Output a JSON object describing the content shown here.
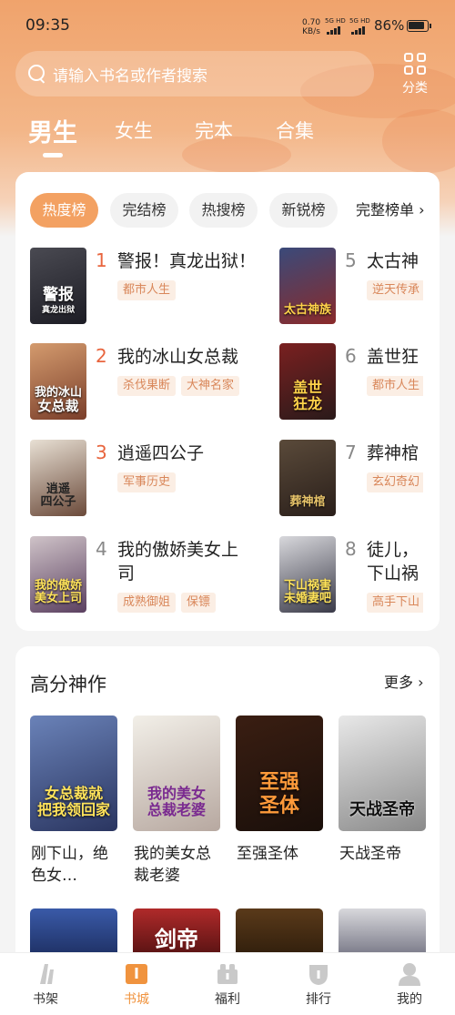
{
  "status_bar": {
    "time": "09:35",
    "speed_value": "0.70",
    "speed_unit": "KB/s",
    "sim1": "5G HD",
    "sim2": "5G HD",
    "battery": "86%"
  },
  "search": {
    "placeholder": "请输入书名或作者搜索"
  },
  "category_button": {
    "label": "分类",
    "icon": "grid-icon"
  },
  "tabs": [
    {
      "label": "男生",
      "active": true
    },
    {
      "label": "女生",
      "active": false
    },
    {
      "label": "完本",
      "active": false
    },
    {
      "label": "合集",
      "active": false
    }
  ],
  "ranking": {
    "tabs": [
      {
        "label": "热度榜",
        "active": true
      },
      {
        "label": "完结榜",
        "active": false
      },
      {
        "label": "热搜榜",
        "active": false
      },
      {
        "label": "新锐榜",
        "active": false
      }
    ],
    "full_list_label": "完整榜单",
    "books": [
      {
        "rank": "1",
        "title": "警报！真龙出狱！",
        "title2": "",
        "tags": [
          "都市人生"
        ],
        "cover_text": "警报",
        "cover_sub": "真龙出狱"
      },
      {
        "rank": "2",
        "title": "我的冰山女总裁",
        "title2": "",
        "tags": [
          "杀伐果断",
          "大神名家"
        ],
        "cover_text": "我的冰山",
        "cover_sub": "女总裁"
      },
      {
        "rank": "3",
        "title": "逍遥四公子",
        "title2": "",
        "tags": [
          "军事历史"
        ],
        "cover_text": "逍遥",
        "cover_sub": "四公子"
      },
      {
        "rank": "4",
        "title": "我的傲娇美女上",
        "title2": "司",
        "tags": [
          "成熟御姐",
          "保镖"
        ],
        "cover_text": "我的傲娇",
        "cover_sub": "美女上司"
      },
      {
        "rank": "5",
        "title": "太古神",
        "title2": "",
        "tags": [
          "逆天传承"
        ],
        "cover_text": "太古神族",
        "cover_sub": ""
      },
      {
        "rank": "6",
        "title": "盖世狂",
        "title2": "",
        "tags": [
          "都市人生"
        ],
        "cover_text": "盖世",
        "cover_sub": "狂龙"
      },
      {
        "rank": "7",
        "title": "葬神棺",
        "title2": "",
        "tags": [
          "玄幻奇幻"
        ],
        "cover_text": "葬神棺",
        "cover_sub": ""
      },
      {
        "rank": "8",
        "title": "徒儿，",
        "title2": "下山祸",
        "tags": [
          "高手下山"
        ],
        "cover_text": "下山祸害",
        "cover_sub": "未婚妻吧"
      }
    ]
  },
  "high_score": {
    "title": "高分神作",
    "more_label": "更多",
    "books": [
      {
        "title": "刚下山，绝色女…",
        "cover_text": "女总裁就",
        "cover_sub": "把我领回家"
      },
      {
        "title": "我的美女总裁老婆",
        "cover_text": "我的美女",
        "cover_sub": "总裁老婆"
      },
      {
        "title": "至强圣体",
        "cover_text": "至强",
        "cover_sub": "圣体"
      },
      {
        "title": "天战圣帝",
        "cover_text": "天战圣帝",
        "cover_sub": ""
      }
    ],
    "next_row_cover_text": [
      "",
      "剑帝",
      "",
      ""
    ]
  },
  "bottom_nav": [
    {
      "label": "书架",
      "icon": "bookshelf-icon",
      "active": false
    },
    {
      "label": "书城",
      "icon": "book-store-icon",
      "active": true
    },
    {
      "label": "福利",
      "icon": "gift-icon",
      "active": false
    },
    {
      "label": "排行",
      "icon": "trophy-icon",
      "active": false
    },
    {
      "label": "我的",
      "icon": "profile-icon",
      "active": false
    }
  ],
  "colors": {
    "accent": "#f3a162",
    "tag_text": "#d9875a",
    "tag_bg": "#fbeee4",
    "nav_active": "#f0933e"
  }
}
